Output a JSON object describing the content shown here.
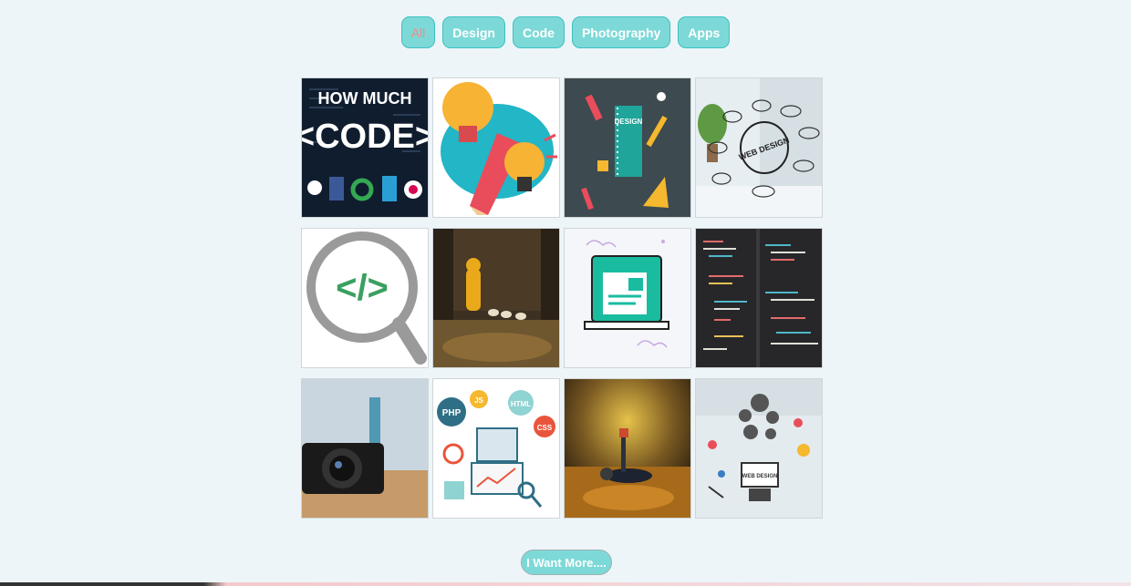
{
  "filters": [
    {
      "label": "All",
      "active": true
    },
    {
      "label": "Design",
      "active": false
    },
    {
      "label": "Code",
      "active": false
    },
    {
      "label": "Photography",
      "active": false
    },
    {
      "label": "Apps",
      "active": false
    }
  ],
  "gallery": {
    "tiles": [
      {
        "subject": "how-much-code-poster",
        "line1": "HOW MUCH",
        "line2": "<CODE>"
      },
      {
        "subject": "lightbulbs-pencil-illustration"
      },
      {
        "subject": "design-notebook-tools-illustration",
        "label": "DESIGN"
      },
      {
        "subject": "web-design-sketch-photo",
        "label": "WEB DESIGN"
      },
      {
        "subject": "code-magnifier-icon",
        "glyph": "</>"
      },
      {
        "subject": "child-with-ducklings-photo"
      },
      {
        "subject": "laptop-illustration"
      },
      {
        "subject": "code-editor-screenshot"
      },
      {
        "subject": "camera-closeup-photo"
      },
      {
        "subject": "web-dev-icons-illustration",
        "labels": [
          "PHP",
          "JS",
          "HTML",
          "CSS"
        ]
      },
      {
        "subject": "child-in-autumn-leaves-photo"
      },
      {
        "subject": "web-design-gears-sketch-photo",
        "label": "WEB DESIGN"
      }
    ]
  },
  "more_button": {
    "label": "I Want More...."
  },
  "colors": {
    "background": "#eef5f9",
    "button_fill": "#7dd9d7",
    "button_border": "#3cc1c1",
    "active_text": "#ee8c88"
  }
}
